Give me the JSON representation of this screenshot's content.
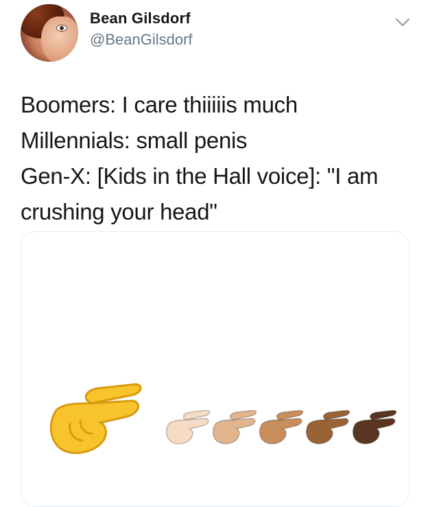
{
  "author": {
    "name": "Bean Gilsdorf",
    "handle": "@BeanGilsdorf"
  },
  "tweet": {
    "lines": [
      "Boomers: I care thiiiiis much",
      "Millennials: small penis",
      "Gen-X: [Kids in the Hall voice]: \"I am",
      "crushing your head\""
    ]
  },
  "media": {
    "emoji": "pinching-hand",
    "skin_tones": [
      "#f7c42c",
      "#f6dcc4",
      "#e3b58e",
      "#c98e5d",
      "#9a6336",
      "#5a3622"
    ]
  },
  "icons": {
    "more": "chevron-down-icon",
    "avatar": "profile-photo"
  }
}
